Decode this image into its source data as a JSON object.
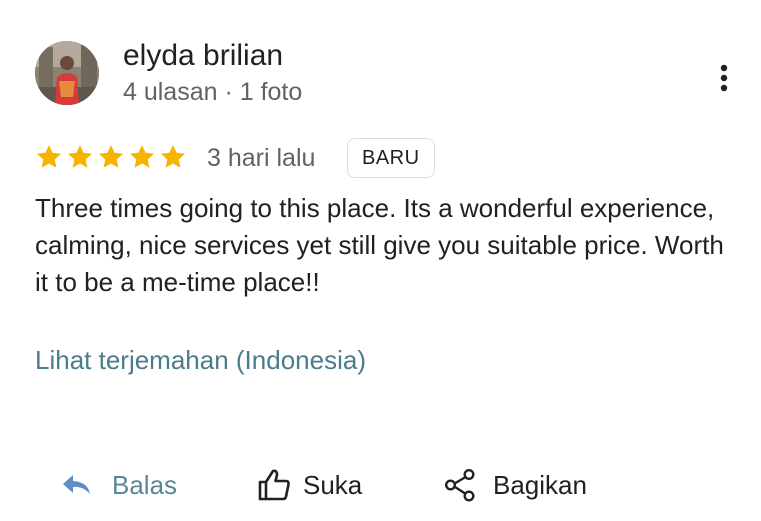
{
  "review": {
    "author_name": "elyda brilian",
    "author_meta": "4 ulasan · 1 foto",
    "rating": 5,
    "rating_max": 5,
    "time_ago": "3 hari lalu",
    "badge": "BARU",
    "text": "Three times going to this place. Its a wonderful experience, calming, nice services yet still give you suitable price. Worth it to be a me-time place!!",
    "translate_link": "Lihat terjemahan (Indonesia)"
  },
  "actions": {
    "reply_label": "Balas",
    "like_label": "Suka",
    "share_label": "Bagikan"
  },
  "icons": {
    "more": "more-vert-icon",
    "star": "star-icon",
    "reply": "reply-icon",
    "like": "thumb-up-icon",
    "share": "share-icon"
  },
  "colors": {
    "star": "#f4b400",
    "link": "#4b7c8c",
    "reply_accent": "#5f8dc5",
    "secondary_text": "#5f6368",
    "badge_border": "#dadce0"
  }
}
